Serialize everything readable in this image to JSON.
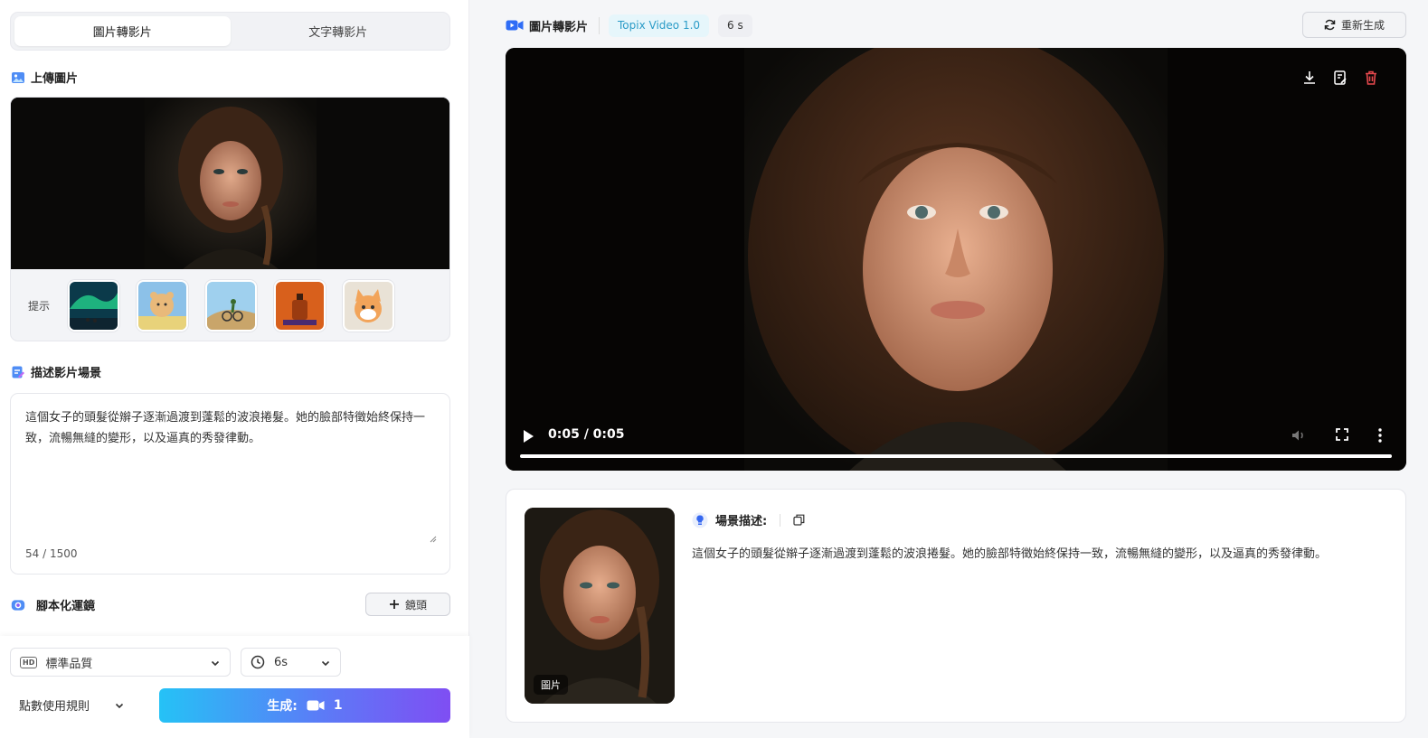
{
  "tabs": [
    {
      "label": "圖片轉影片",
      "active": true
    },
    {
      "label": "文字轉影片",
      "active": false
    }
  ],
  "upload": {
    "title": "上傳圖片",
    "hint_label": "提示",
    "hint_thumbs": [
      "aurora-thumb",
      "bear-thumb",
      "cyclist-thumb",
      "perfume-thumb",
      "cat-thumb"
    ]
  },
  "description": {
    "title": "描述影片場景",
    "text": "這個女子的頭髮從辮子逐漸過渡到蓬鬆的波浪捲髮。她的臉部特徵始終保持一致，流暢無縫的變形，以及逼真的秀發律動。",
    "count": "54 / 1500"
  },
  "storyboard": {
    "title": "腳本化運鏡",
    "add_label": "鏡頭"
  },
  "bottom": {
    "quality": "標準品質",
    "quality_badge": "HD",
    "duration": "6s",
    "rules": "點數使用規則",
    "generate_label": "生成:",
    "generate_count": "1"
  },
  "result": {
    "title": "圖片轉影片",
    "model": "Topix Video 1.0",
    "duration": "6 s",
    "regen_label": "重新生成",
    "video_time": "0:05 / 0:05",
    "scene_title": "場景描述:",
    "scene_text": "這個女子的頭髮從辮子逐漸過渡到蓬鬆的波浪捲髮。她的臉部特徵始終保持一致，流暢無縫的變形，以及逼真的秀發律動。",
    "image_tag": "圖片"
  },
  "colors": {
    "accent_start": "#25c2f6",
    "accent_end": "#7f4ef3",
    "delete": "#e5484d"
  }
}
